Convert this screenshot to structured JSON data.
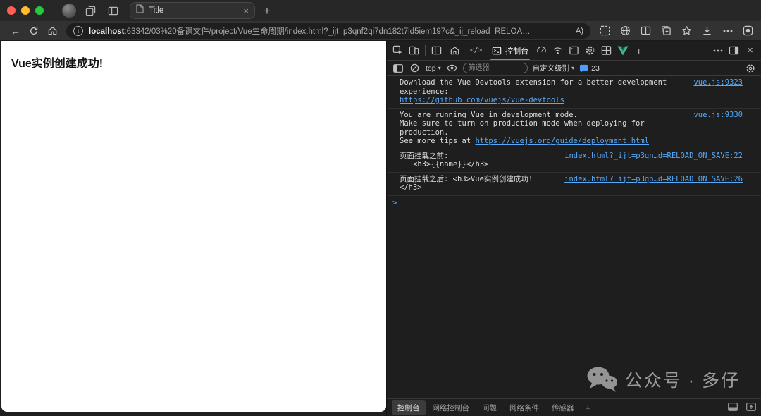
{
  "colors": {
    "traffic_red": "#ff5f57",
    "traffic_yellow": "#febc2e",
    "traffic_green": "#28c840",
    "link_blue": "#56a8f8",
    "accent_blue": "#4d9ef6",
    "vue_green": "#41b883"
  },
  "browser": {
    "tab_title": "Title",
    "url": {
      "host": "localhost",
      "rest": ":63342/03%20备课文件/project/Vue生命周期/index.html?_ijt=p3qnf2qi7dn182t7ld5iem197c&_ij_reload=RELOA…"
    }
  },
  "page": {
    "heading": "Vue实例创建成功!"
  },
  "devtools": {
    "console_tab_label": "控制台",
    "console_toolbar": {
      "context_selector": "top",
      "filter_placeholder": "筛选器",
      "levels_label": "自定义级别",
      "messages_count": "23"
    },
    "messages": {
      "m1": {
        "text": "Download the Vue Devtools extension for a better development experience:",
        "link": "https://github.com/vuejs/vue-devtools",
        "source": "vue.js:9323"
      },
      "m2": {
        "line1": "You are running Vue in development mode.",
        "line2": "Make sure to turn on production mode when deploying for production.",
        "line3_prefix": "See more tips at ",
        "line3_link": "https://vuejs.org/guide/deployment.html",
        "source": "vue.js:9330"
      },
      "m3": {
        "line1": "页面挂载之前:",
        "line2": "<h3>{{name}}</h3>",
        "source": "index.html?_ijt=p3qn…d=RELOAD_ON_SAVE:22"
      },
      "m4": {
        "line1": "页面挂载之后: <h3>Vue实例创建成功! </h3>",
        "source": "index.html?_ijt=p3qn…d=RELOAD_ON_SAVE:26"
      }
    },
    "watermark": "公众号 · 多仔",
    "drawer": {
      "tabs": [
        "控制台",
        "网络控制台",
        "问题",
        "网络条件",
        "传感器"
      ]
    }
  }
}
